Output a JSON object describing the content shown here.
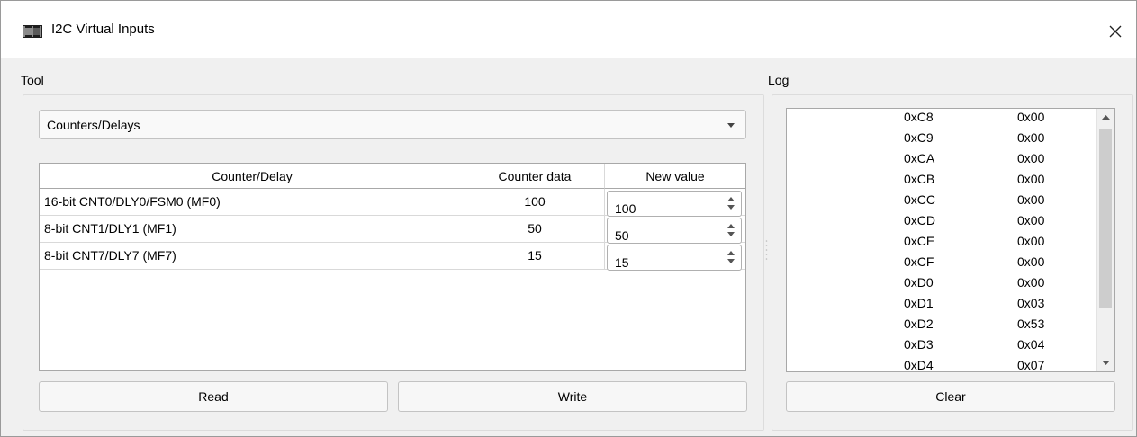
{
  "window": {
    "title": "I2C Virtual Inputs"
  },
  "tool": {
    "group_label": "Tool",
    "dropdown_selected": "Counters/Delays",
    "table": {
      "headers": [
        "Counter/Delay",
        "Counter data",
        "New value"
      ],
      "rows": [
        {
          "name": "16-bit CNT0/DLY0/FSM0 (MF0)",
          "data": "100",
          "new_value": "100"
        },
        {
          "name": "8-bit CNT1/DLY1 (MF1)",
          "data": "50",
          "new_value": "50"
        },
        {
          "name": "8-bit CNT7/DLY7 (MF7)",
          "data": "15",
          "new_value": "15"
        }
      ]
    },
    "read_label": "Read",
    "write_label": "Write"
  },
  "log": {
    "group_label": "Log",
    "entries": [
      {
        "addr": "0xC8",
        "val": "0x00"
      },
      {
        "addr": "0xC9",
        "val": "0x00"
      },
      {
        "addr": "0xCA",
        "val": "0x00"
      },
      {
        "addr": "0xCB",
        "val": "0x00"
      },
      {
        "addr": "0xCC",
        "val": "0x00"
      },
      {
        "addr": "0xCD",
        "val": "0x00"
      },
      {
        "addr": "0xCE",
        "val": "0x00"
      },
      {
        "addr": "0xCF",
        "val": "0x00"
      },
      {
        "addr": "0xD0",
        "val": "0x00"
      },
      {
        "addr": "0xD1",
        "val": "0x03"
      },
      {
        "addr": "0xD2",
        "val": "0x53"
      },
      {
        "addr": "0xD3",
        "val": "0x04"
      },
      {
        "addr": "0xD4",
        "val": "0x07"
      }
    ],
    "clear_label": "Clear"
  }
}
